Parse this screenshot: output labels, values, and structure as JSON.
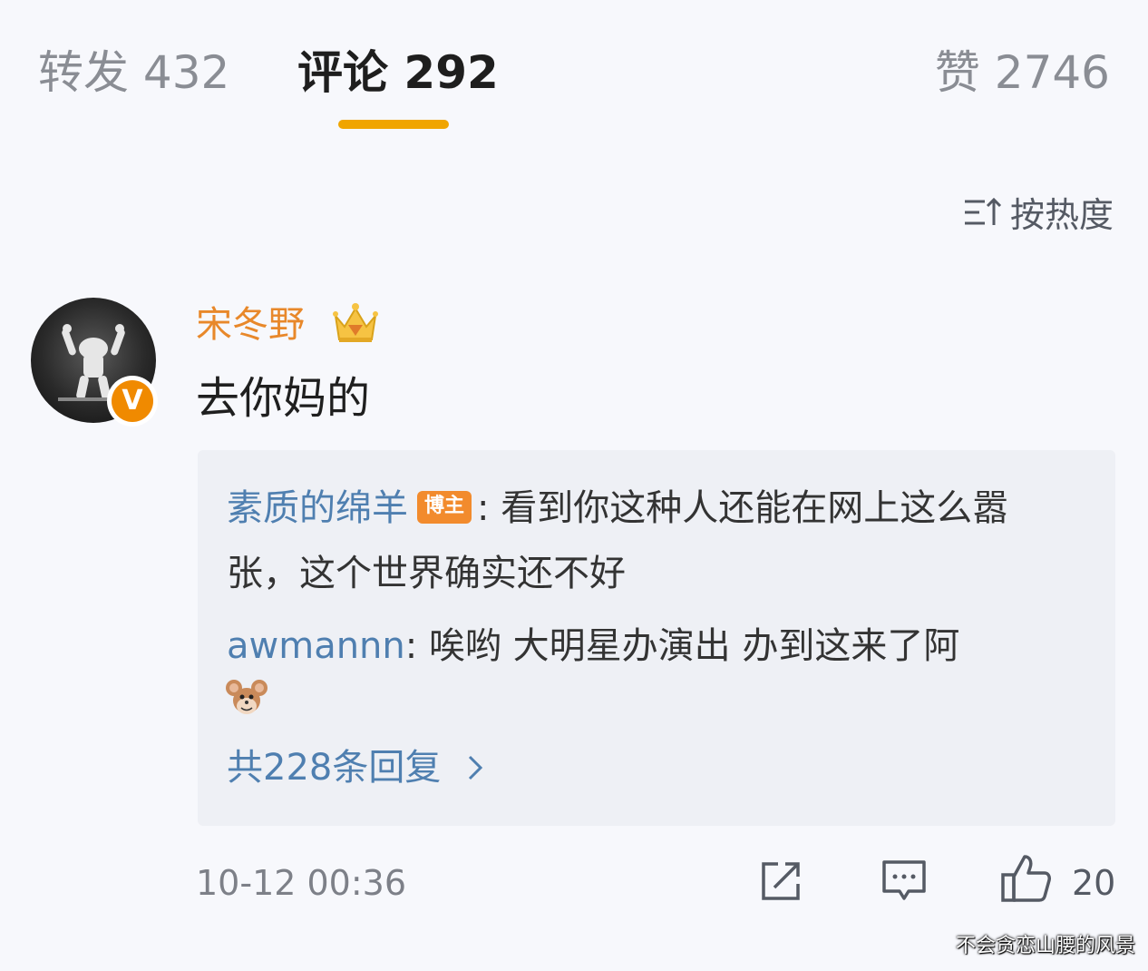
{
  "tabs": {
    "repost": "转发 432",
    "comment": "评论 292",
    "like": "赞 2746"
  },
  "sort": {
    "label": "按热度",
    "icon": "sort-icon"
  },
  "comment": {
    "username": "宋冬野",
    "text": "去你妈的",
    "badge": "V",
    "crown_icon": "crown-icon",
    "timestamp": "10-12 00:36",
    "like_count": "20"
  },
  "replies": [
    {
      "author": "素质的绵羊",
      "tag": "博主",
      "text": ": 看到你这种人还能在网上这么嚣张，这个世界确实还不好"
    },
    {
      "author": "awmannn",
      "text": ": 唉哟 大明星办演出 办到这来了阿"
    }
  ],
  "more_replies": "共228条回复",
  "colors": {
    "accent": "#f0a500",
    "username": "#e8882a",
    "link": "#4f7fb0",
    "reply_bg": "#eef0f5"
  },
  "watermark": "不会贪恋山腰的风景"
}
